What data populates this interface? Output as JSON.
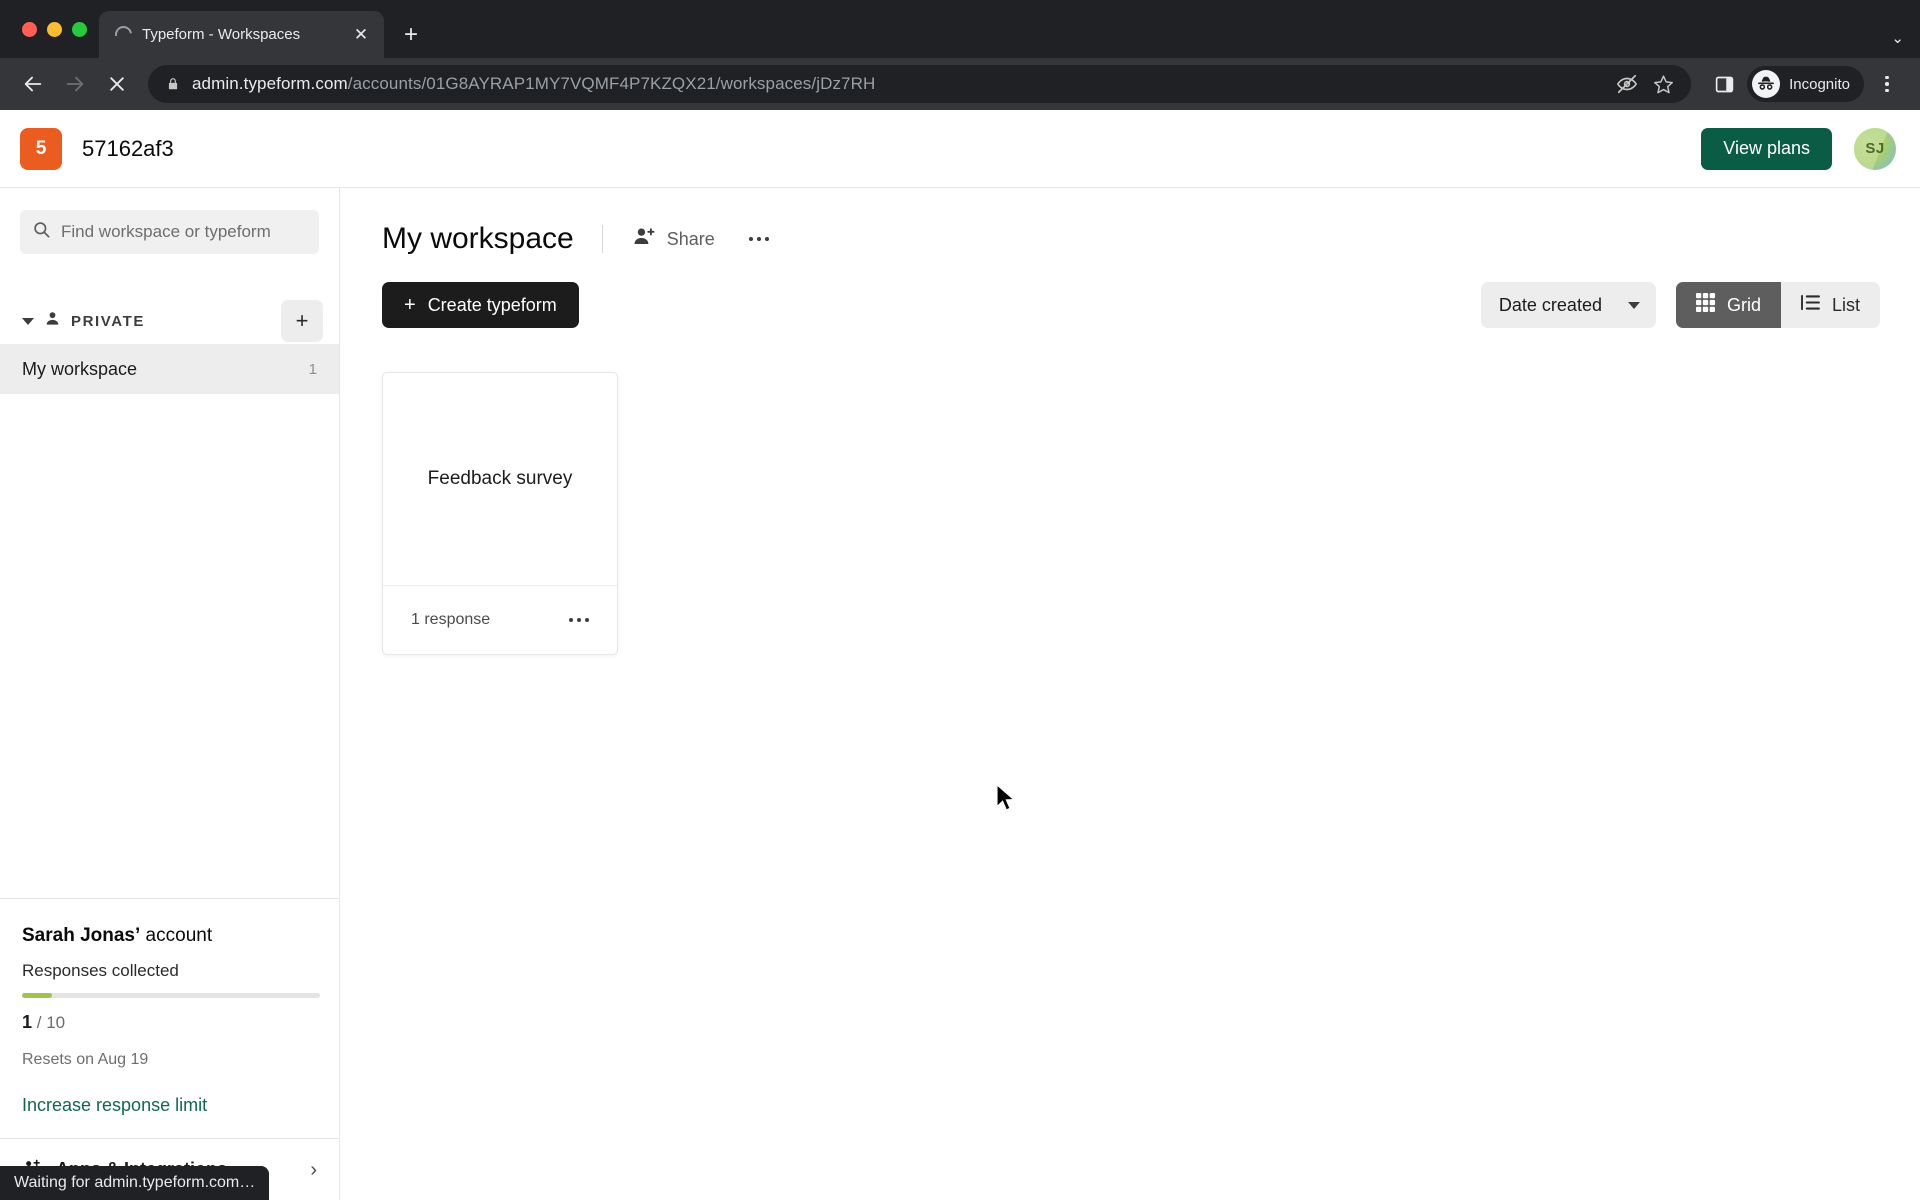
{
  "browser": {
    "tab": {
      "title": "Typeform - Workspaces",
      "close_label": "✕",
      "spinner": "loading-spinner"
    },
    "new_tab_label": "+",
    "tabstrip_menu": "⌄",
    "omnibox": {
      "lock_icon": "lock-icon",
      "url_domain": "admin.typeform.com",
      "url_path": "/accounts/01G8AYRAP1MY7VQMF4P7KZQX21/workspaces/jDz7RH"
    },
    "profile": {
      "label": "Incognito",
      "icon": "incognito-icon"
    },
    "status_text": "Waiting for admin.typeform.com…"
  },
  "app_header": {
    "account_badge": "5",
    "account_name": "57162af3",
    "view_plans_label": "View plans",
    "avatar_initials": "SJ"
  },
  "sidebar": {
    "search_placeholder": "Find workspace or typeform",
    "search_value": "",
    "section_label": "PRIVATE",
    "add_workspace_label": "+",
    "workspaces": [
      {
        "name": "My workspace",
        "count": "1"
      }
    ],
    "account_panel": {
      "owner": "Sarah Jonas’",
      "owner_suffix": " account",
      "responses_label": "Responses collected",
      "used": "1",
      "limit": "/ 10",
      "progress_percent": 10,
      "resets": "Resets on Aug 19",
      "increase_link": "Increase response limit"
    },
    "apps_row": {
      "label": "Apps & Integrations",
      "chevron": "›"
    }
  },
  "main": {
    "workspace_title": "My workspace",
    "share_label": "Share",
    "more_label": "more-options",
    "create_label": "Create typeform",
    "sort_label": "Date created",
    "view_grid_label": "Grid",
    "view_list_label": "List",
    "active_view": "Grid",
    "cards": [
      {
        "title": "Feedback survey",
        "responses": "1 response"
      }
    ]
  },
  "colors": {
    "accent_green": "#0b5c44",
    "badge_orange": "#eb5c20",
    "progress_green": "#9ec34e",
    "link_green": "#12674c",
    "dark_button": "#1c1c1c"
  }
}
